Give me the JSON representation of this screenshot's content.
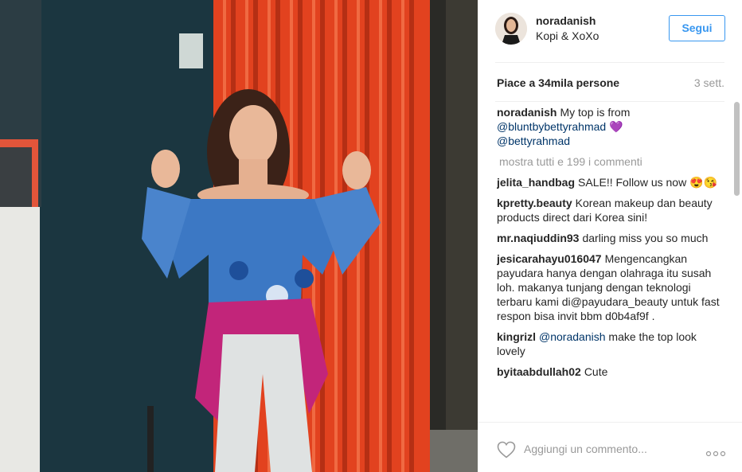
{
  "post": {
    "username": "noradanish",
    "location": "Kopi & XoXo",
    "follow_label": "Segui",
    "likes": "Piace a 34mila persone",
    "time_ago": "3 sett.",
    "caption": {
      "user": "noradanish",
      "text_before": "My top is from",
      "mention1": "@bluntbybettyrahmad",
      "emoji": "💜",
      "mention2": "@bettyrahmad"
    },
    "show_all_comments": "mostra tutti e 199 i commenti",
    "comments": [
      {
        "user": "jelita_handbag",
        "text": "SALE!! Follow us now 😍😘"
      },
      {
        "user": "kpretty.beauty",
        "text": "Korean makeup dan beauty products direct dari Korea sini!"
      },
      {
        "user": "mr.naqiuddin93",
        "text": "darling miss you so much"
      },
      {
        "user": "jesicarahayu016047",
        "text": "Mengencangkan payudara hanya dengan olahraga itu susah loh. makanya tunjang dengan teknologi terbaru kami di@payudara_beauty untuk fast respon bisa invit bbm d0b4af9f ."
      },
      {
        "user": "kingrizl",
        "mention": "@noradanish",
        "text": "make the top look lovely"
      },
      {
        "user": "byitaabdullah02",
        "text": "Cute"
      }
    ],
    "comment_placeholder": "Aggiungi un commento...",
    "icons": {
      "like": "heart-icon",
      "more": "more-options-icon"
    },
    "colors": {
      "accent": "#3897f0",
      "mention": "#003569",
      "muted": "#999999"
    }
  }
}
